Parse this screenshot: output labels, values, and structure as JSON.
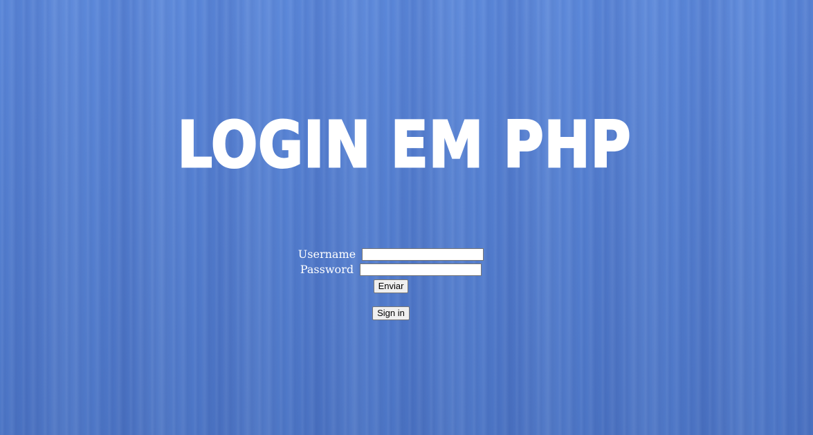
{
  "page": {
    "title": "LOGIN EM PHP",
    "background_color": "#5583d8"
  },
  "form": {
    "username_label": "Username",
    "username_value": "",
    "password_label": "Password",
    "password_value": "",
    "submit_label": "Enviar"
  },
  "signin": {
    "button_label": "Sign in"
  }
}
